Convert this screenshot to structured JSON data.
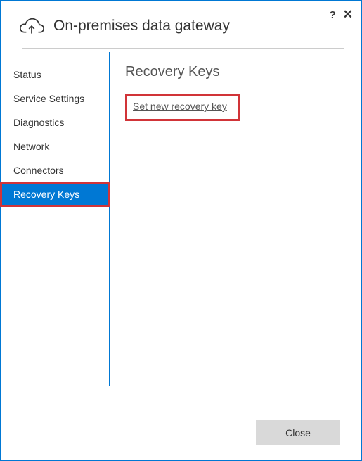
{
  "header": {
    "title": "On-premises data gateway",
    "help_label": "?",
    "close_label": "✕"
  },
  "sidebar": {
    "items": [
      {
        "label": "Status",
        "active": false
      },
      {
        "label": "Service Settings",
        "active": false
      },
      {
        "label": "Diagnostics",
        "active": false
      },
      {
        "label": "Network",
        "active": false
      },
      {
        "label": "Connectors",
        "active": false
      },
      {
        "label": "Recovery Keys",
        "active": true
      }
    ]
  },
  "main": {
    "heading": "Recovery Keys",
    "link_label": "Set new recovery key"
  },
  "footer": {
    "close_button": "Close"
  }
}
